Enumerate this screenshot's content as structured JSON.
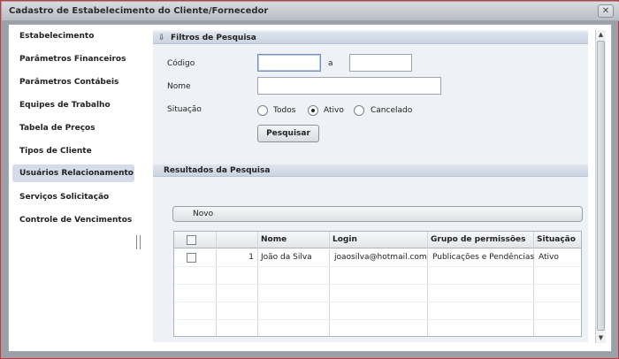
{
  "window": {
    "title": "Cadastro de Estabelecimento do Cliente/Fornecedor",
    "close_label": "✕"
  },
  "sidebar": {
    "items": [
      {
        "label": "Estabelecimento",
        "active": false
      },
      {
        "label": "Parâmetros Financeiros",
        "active": false
      },
      {
        "label": "Parâmetros Contábeis",
        "active": false
      },
      {
        "label": "Equipes de Trabalho",
        "active": false
      },
      {
        "label": "Tabela de Preços",
        "active": false
      },
      {
        "label": "Tipos de Cliente",
        "active": false
      },
      {
        "label": "Usuários Relacionamento",
        "active": true
      },
      {
        "label": "Serviços Solicitação",
        "active": false
      },
      {
        "label": "Controle de Vencimentos",
        "active": false
      }
    ]
  },
  "filters": {
    "title": "Filtros de Pesquisa",
    "codigo_label": "Código",
    "range_sep": "a",
    "codigo_from": "",
    "codigo_to": "",
    "nome_label": "Nome",
    "nome_value": "",
    "situacao_label": "Situação",
    "situacao_options": [
      "Todos",
      "Ativo",
      "Cancelado"
    ],
    "situacao_selected": "Ativo",
    "search_button": "Pesquisar"
  },
  "results": {
    "title": "Resultados da Pesquisa",
    "new_button": "Novo",
    "columns": [
      "Nome",
      "Login",
      "Grupo de permissões",
      "Situação"
    ],
    "rows": [
      {
        "index": "1",
        "nome": "João da Silva",
        "login": "joaosilva@hotmail.com",
        "grupo": "Publicações e Pendências",
        "situacao": "Ativo"
      }
    ]
  }
}
